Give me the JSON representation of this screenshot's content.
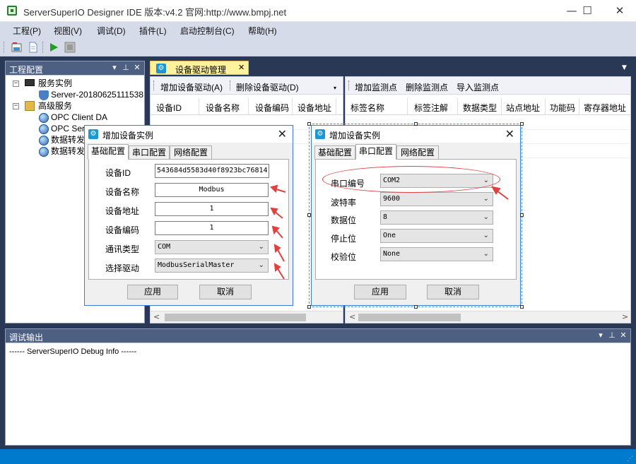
{
  "window": {
    "title": "ServerSuperIO Designer IDE 版本:v4.2 官网:http://www.bmpj.net",
    "minimize": "—",
    "maximize": "☐",
    "close": "✕"
  },
  "menu": [
    "工程(P)",
    "视图(V)",
    "调试(D)",
    "插件(L)",
    "启动控制台(C)",
    "帮助(H)"
  ],
  "toolbar_icons": [
    "open-project-icon",
    "document-icon",
    "run-icon",
    "stop-icon"
  ],
  "left_panel": {
    "title": "工程配置",
    "tree": {
      "service_instance": "服务实例",
      "server_node": "Server-20180625111538",
      "advanced_services": "高级服务",
      "opc_client": "OPC Client DA",
      "opc_server": "OPC Serv",
      "forward_1": "数据转发",
      "forward_2": "数据转发"
    }
  },
  "doc_tab": {
    "label": "设备驱动管理",
    "close": "✕",
    "icon": "⚙"
  },
  "device_pane": {
    "add_button": "增加设备驱动(A)",
    "delete_button": "删除设备驱动(D)",
    "columns": [
      "设备ID",
      "设备名称",
      "设备编码",
      "设备地址"
    ]
  },
  "monitor_pane": {
    "add_button": "增加监测点",
    "delete_button": "删除监测点",
    "import_button": "导入监测点",
    "columns": [
      "标签名称",
      "标签注解",
      "数据类型",
      "站点地址",
      "功能码",
      "寄存器地址"
    ]
  },
  "bottom_panel": {
    "title": "调试输出",
    "text": "------ ServerSuperIO Debug Info ------"
  },
  "dialog_basic": {
    "title": "增加设备实例",
    "close": "✕",
    "tabs": [
      "基础配置",
      "串口配置",
      "网络配置"
    ],
    "fields": {
      "device_id_label": "设备ID",
      "device_id_value": "543684d5583d40f8923bc76814",
      "device_name_label": "设备名称",
      "device_name_value": "Modbus",
      "device_addr_label": "设备地址",
      "device_addr_value": "1",
      "device_code_label": "设备编码",
      "device_code_value": "1",
      "comm_type_label": "通讯类型",
      "comm_type_value": "COM",
      "driver_label": "选择驱动",
      "driver_value": "ModbusSerialMaster"
    },
    "apply": "应用",
    "cancel": "取消"
  },
  "dialog_serial": {
    "title": "增加设备实例",
    "close": "✕",
    "tabs": [
      "基础配置",
      "串口配置",
      "网络配置"
    ],
    "fields": {
      "port_label": "串口编号",
      "port_value": "COM2",
      "baud_label": "波特率",
      "baud_value": "9600",
      "databits_label": "数据位",
      "databits_value": "8",
      "stopbits_label": "停止位",
      "stopbits_value": "One",
      "parity_label": "校验位",
      "parity_value": "None"
    },
    "apply": "应用",
    "cancel": "取消"
  },
  "colors": {
    "chrome": "#293955",
    "menubar": "#d6dbe9",
    "active_tab": "#fff29d",
    "status": "#007acc",
    "annotation": "#e34040"
  }
}
